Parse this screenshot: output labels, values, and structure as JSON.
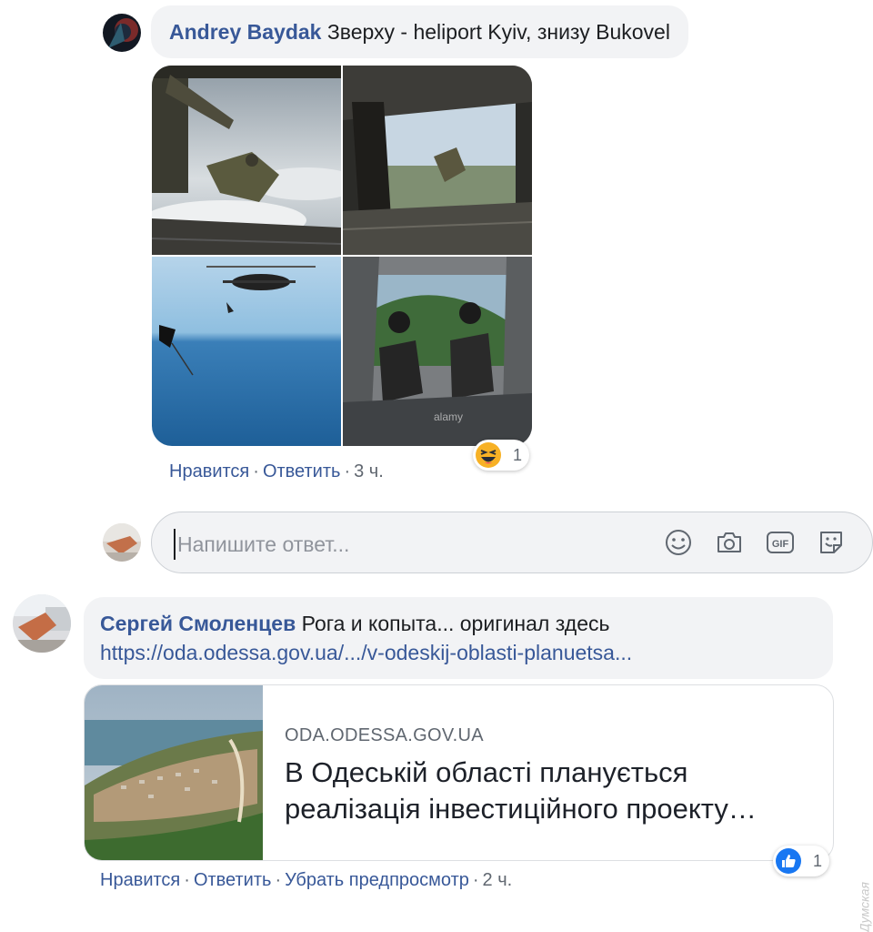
{
  "comment1": {
    "author": "Andrey Baydak",
    "text": "Зверху - heliport Kyiv, знизу Bukovel",
    "reaction_icon": "haha-emoji-icon",
    "reaction_count": "1",
    "actions": {
      "like": "Нравится",
      "reply": "Ответить",
      "time": "3 ч."
    },
    "photo_watermark": "alamy"
  },
  "reply_box": {
    "placeholder": "Напишите ответ...",
    "icons": [
      "emoji-icon",
      "camera-icon",
      "gif-icon",
      "sticker-icon"
    ],
    "gif_label": "GIF"
  },
  "comment2": {
    "author": "Сергей Смоленцев",
    "text": "Рога и копыта... оригинал здесь",
    "link": "https://oda.odessa.gov.ua/.../v-odeskij-oblasti-planuetsa...",
    "preview": {
      "domain": "ODA.ODESSA.GOV.UA",
      "title_line1": "В Одеській області планується",
      "title_line2": "реалізація інвестиційного проекту…"
    },
    "reaction_icon": "like-icon",
    "reaction_count": "1",
    "actions": {
      "like": "Нравится",
      "reply": "Ответить",
      "remove_preview": "Убрать предпросмотр",
      "time": "2 ч."
    }
  },
  "watermark": "Думская",
  "colors": {
    "author": "#385898",
    "bubble": "#f2f3f5",
    "meta": "#606770",
    "like_blue": "#1877f2",
    "haha_yellow": "#f7b125"
  }
}
